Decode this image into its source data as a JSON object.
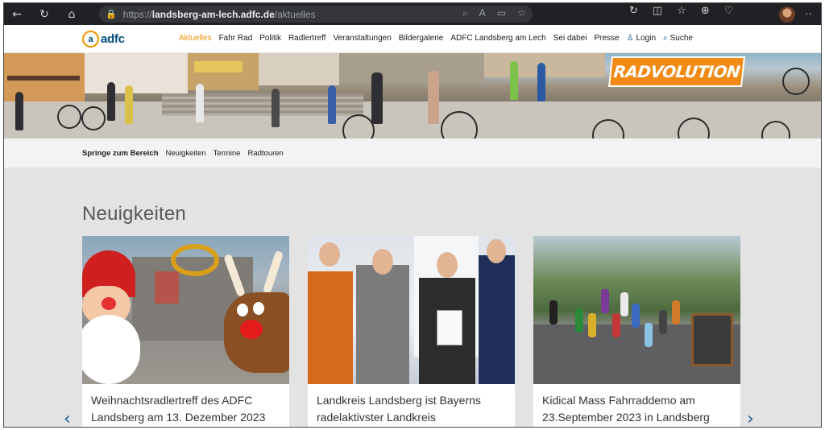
{
  "browser": {
    "url_scheme": "https://",
    "url_host": "landsberg-am-lech.adfc.de",
    "url_path": "/aktuelles"
  },
  "site": {
    "logo_mark": "a",
    "logo_text": "adfc",
    "nav": [
      {
        "label": "Aktuelles",
        "active": true
      },
      {
        "label": "Fahr Rad"
      },
      {
        "label": "Politik"
      },
      {
        "label": "Radlertreff"
      },
      {
        "label": "Veranstaltungen"
      },
      {
        "label": "Bildergalerie"
      },
      {
        "label": "ADFC Landsberg am Lech"
      },
      {
        "label": "Sei dabei"
      },
      {
        "label": "Presse"
      },
      {
        "label": "Login"
      },
      {
        "label": "Suche"
      }
    ],
    "hero_badge": "RADVOLUTION"
  },
  "jump": {
    "title": "Springe zum Bereich",
    "links": [
      "Neuigkeiten",
      "Termine",
      "Radtouren"
    ]
  },
  "news": {
    "title": "Neuigkeiten",
    "cards": [
      {
        "text": "Weihnachtsradlertreff des ADFC Landsberg am 13. Dezember 2023"
      },
      {
        "text": "Landkreis Landsberg ist Bayerns radelaktivster Landkreis"
      },
      {
        "text": "Kidical Mass Fahrraddemo am 23.September 2023 in Landsberg"
      }
    ]
  },
  "colors": {
    "accent": "#f39200",
    "brand_blue": "#004b7c",
    "arrow_blue": "#1f5f96"
  }
}
